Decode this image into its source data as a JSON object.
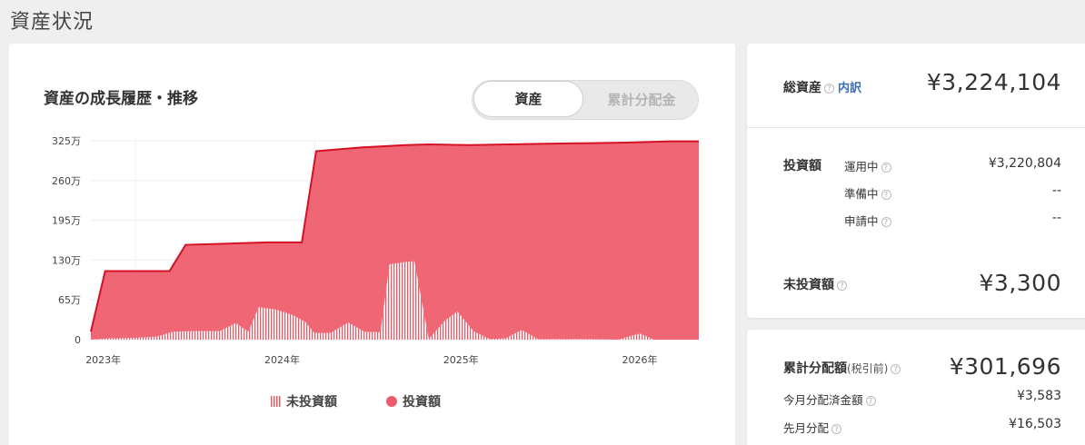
{
  "page": {
    "title": "資産状況"
  },
  "chart_card": {
    "title": "資産の成長履歴・推移",
    "toggle": {
      "active_label": "資産",
      "inactive_label": "累計分配金"
    },
    "legend": {
      "uninvested": "未投資額",
      "invested": "投資額"
    }
  },
  "chart_data": {
    "type": "area",
    "title": "資産の成長履歴・推移",
    "y_unit": "万",
    "ylim": [
      0,
      325
    ],
    "y_ticks": [
      0,
      65,
      130,
      195,
      260,
      325
    ],
    "y_tick_labels": [
      "0",
      "65万",
      "130万",
      "195万",
      "260万",
      "325万"
    ],
    "x_tick_labels": [
      {
        "year": 2023,
        "label": "2023年"
      },
      {
        "year": 2024,
        "label": "2024年"
      },
      {
        "year": 2025,
        "label": "2025年"
      },
      {
        "year": 2026,
        "label": "2026年"
      }
    ],
    "grid": true,
    "series": [
      {
        "name": "投資額",
        "color": "#ee5b6a",
        "points": [
          [
            2022.75,
            13
          ],
          [
            2022.83,
            112
          ],
          [
            2023.19,
            112
          ],
          [
            2023.28,
            155
          ],
          [
            2023.63,
            158
          ],
          [
            2023.74,
            159
          ],
          [
            2023.93,
            159
          ],
          [
            2024.01,
            308
          ],
          [
            2024.26,
            314
          ],
          [
            2024.51,
            318
          ],
          [
            2024.64,
            319
          ],
          [
            2024.87,
            318
          ],
          [
            2025.26,
            320
          ],
          [
            2025.51,
            321
          ],
          [
            2025.75,
            322
          ],
          [
            2025.99,
            324
          ],
          [
            2026.15,
            324
          ]
        ]
      },
      {
        "name": "未投資額",
        "color": "#e85a67",
        "points": [
          [
            2022.75,
            0
          ],
          [
            2022.85,
            2
          ],
          [
            2023.0,
            3
          ],
          [
            2023.12,
            5
          ],
          [
            2023.21,
            13
          ],
          [
            2023.31,
            14
          ],
          [
            2023.47,
            14
          ],
          [
            2023.56,
            27
          ],
          [
            2023.63,
            13
          ],
          [
            2023.69,
            53
          ],
          [
            2023.79,
            49
          ],
          [
            2023.88,
            40
          ],
          [
            2023.95,
            29
          ],
          [
            2024.0,
            11
          ],
          [
            2024.09,
            11
          ],
          [
            2024.19,
            28
          ],
          [
            2024.28,
            13
          ],
          [
            2024.37,
            12
          ],
          [
            2024.42,
            123
          ],
          [
            2024.51,
            127
          ],
          [
            2024.56,
            128
          ],
          [
            2024.64,
            1
          ],
          [
            2024.73,
            31
          ],
          [
            2024.8,
            46
          ],
          [
            2024.89,
            14
          ],
          [
            2024.98,
            1
          ],
          [
            2025.07,
            2
          ],
          [
            2025.16,
            16
          ],
          [
            2025.25,
            1
          ],
          [
            2025.4,
            1
          ],
          [
            2025.55,
            1
          ],
          [
            2025.7,
            0
          ],
          [
            2025.82,
            10
          ],
          [
            2025.9,
            0
          ],
          [
            2026.15,
            0
          ]
        ]
      }
    ]
  },
  "summary": {
    "total_assets_label": "総資産",
    "breakdown_link": "内訳",
    "total_assets_value": "¥3,224,104",
    "invested_label": "投資額",
    "operating_label": "運用中",
    "operating_value": "¥3,220,804",
    "preparing_label": "準備中",
    "preparing_value": "--",
    "applying_label": "申請中",
    "applying_value": "--",
    "uninvested_label": "未投資額",
    "uninvested_value": "¥3,300"
  },
  "distribution": {
    "cumulative_label": "累計分配額",
    "cumulative_suffix": "(税引前)",
    "cumulative_value": "¥301,696",
    "this_month_label": "今月分配済金額",
    "this_month_value": "¥3,583",
    "last_month_label": "先月分配",
    "last_month_value": "¥16,503"
  }
}
